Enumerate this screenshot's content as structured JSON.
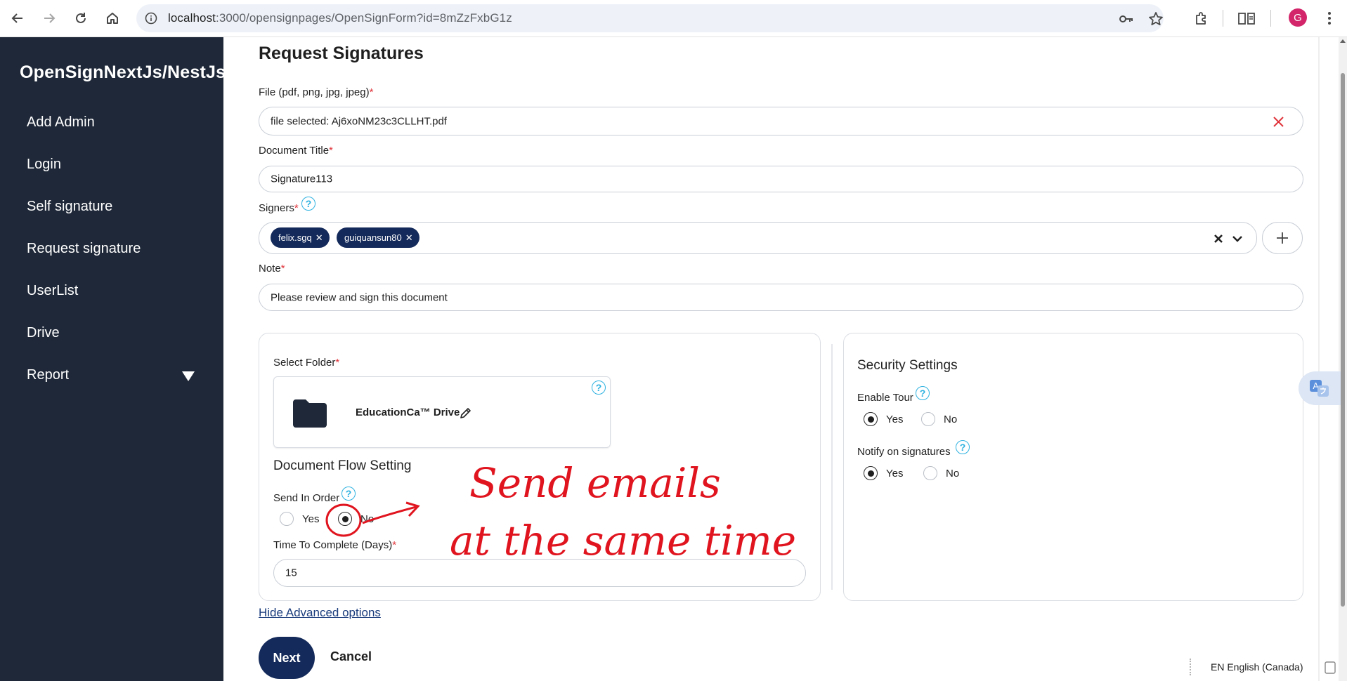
{
  "browser": {
    "url_host": "localhost",
    "url_path": ":3000/opensignpages/OpenSignForm?id=8mZzFxbG1z",
    "avatar_letter": "G"
  },
  "sidebar": {
    "brand": "OpenSignNextJs/NestJs",
    "items": [
      {
        "label": "Add Admin"
      },
      {
        "label": "Login"
      },
      {
        "label": "Self signature"
      },
      {
        "label": "Request signature"
      },
      {
        "label": "UserList"
      },
      {
        "label": "Drive"
      },
      {
        "label": "Report"
      }
    ]
  },
  "form": {
    "title": "Request Signatures",
    "file_label": "File (pdf, png, jpg, jpeg)",
    "file_value": "file selected: Aj6xoNM23c3CLLHT.pdf",
    "doc_title_label": "Document Title",
    "doc_title_value": "Signature113",
    "signers_label": "Signers",
    "signers": [
      "felix.sgq",
      "guiquansun80"
    ],
    "note_label": "Note",
    "note_value": "Please review and sign this document",
    "required_mark": "*",
    "help_glyph": "?"
  },
  "folder": {
    "label": "Select Folder",
    "name": "EducationCa™ Drive"
  },
  "flow": {
    "title": "Document Flow Setting",
    "send_in_order_label": "Send In Order",
    "yes": "Yes",
    "no": "No",
    "send_in_order_selected": "No",
    "time_label": "Time To Complete (Days)",
    "time_value": "15"
  },
  "security": {
    "title": "Security Settings",
    "enable_tour_label": "Enable Tour",
    "enable_tour_selected": "Yes",
    "notify_label": "Notify on signatures",
    "notify_selected": "Yes",
    "yes": "Yes",
    "no": "No"
  },
  "actions": {
    "advanced_link": "Hide Advanced options",
    "next": "Next",
    "cancel": "Cancel"
  },
  "footer": {
    "language": "EN English (Canada)"
  },
  "annotation": {
    "line1": "Send emails",
    "line2": "at the same time",
    "color": "#e0141e"
  },
  "colors": {
    "sidebar_bg": "#1e2838",
    "primary": "#142a5a",
    "help_icon": "#2fb2e0",
    "required": "#e0343b"
  }
}
